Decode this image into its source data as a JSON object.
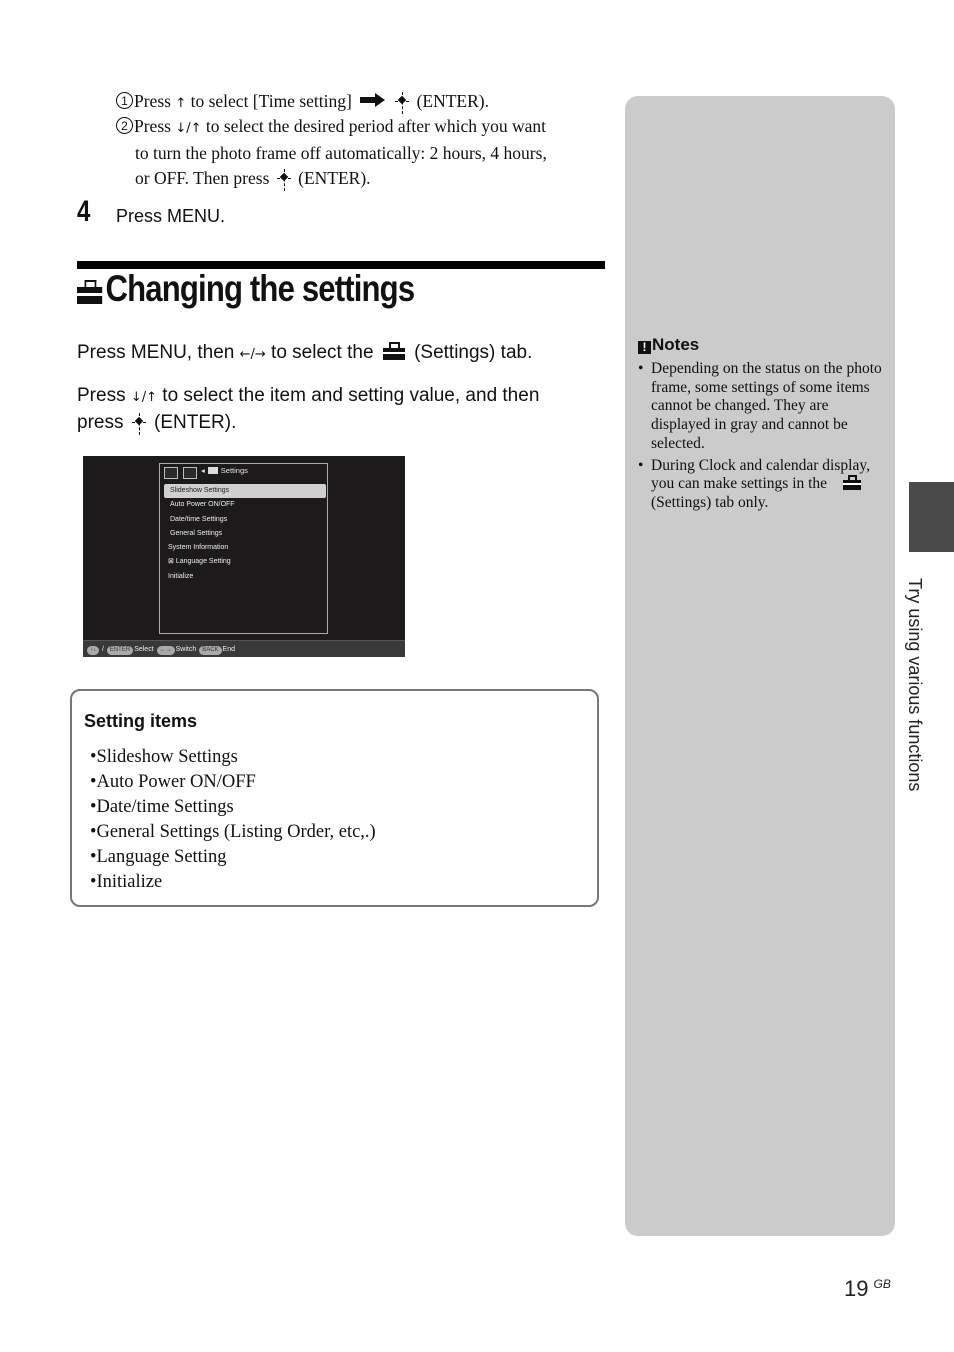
{
  "steps": {
    "sub1": {
      "num": "1",
      "pre": "Press ",
      "arrow": "↑",
      "mid": " to select [Time setting] ",
      "enter": "(ENTER)."
    },
    "sub2": {
      "num": "2",
      "pre": "Press ",
      "arrow": "↓/↑",
      "line1": " to select the desired period after which you want",
      "line2": "to turn the photo frame off automatically:  2 hours, 4 hours,",
      "line3": "or OFF.  Then press ",
      "enter": "(ENTER)."
    },
    "step4": {
      "num": "4",
      "text": "Press MENU."
    }
  },
  "section": {
    "title": "Changing the settings",
    "para1": {
      "pre": "Press MENU, then ",
      "arrow": "←/→",
      "mid": " to select the ",
      "post": " (Settings) tab."
    },
    "para2": {
      "pre": "Press ",
      "arrow": "↓/↑",
      "line1": " to select the item and setting value, and then",
      "line2pre": "press ",
      "line2post": " (ENTER)."
    }
  },
  "screen": {
    "tab_header": "Settings",
    "menu_items": [
      "Slideshow Settings",
      "Auto Power ON/OFF",
      "Date/time Settings",
      "General Settings",
      "System Information",
      "Language Setting",
      "Initialize"
    ],
    "selected_index": 0,
    "footer": {
      "nav_pill": "↑↓",
      "enter_pill": "ENTER",
      "select": "Select",
      "switch_pill": "←→",
      "switch": "Switch",
      "back_pill": "BACK",
      "end": "End"
    }
  },
  "setting_items": {
    "heading": "Setting items",
    "items": [
      "•Slideshow Settings",
      "•Auto Power ON/OFF",
      "•Date/time Settings",
      "•General Settings (Listing Order, etc,.)",
      "•Language Setting",
      "•Initialize"
    ]
  },
  "notes": {
    "heading": "Notes",
    "icon": "!",
    "items": [
      "Depending on the status on the photo frame, some settings of some items cannot be changed. They are displayed in gray and cannot be selected."
    ],
    "item2": {
      "pre": "During Clock and calendar display, you can make settings in the ",
      "post": " (Settings) tab only."
    }
  },
  "side_label": "Try using various functions",
  "page": {
    "number": "19",
    "region": "GB"
  }
}
